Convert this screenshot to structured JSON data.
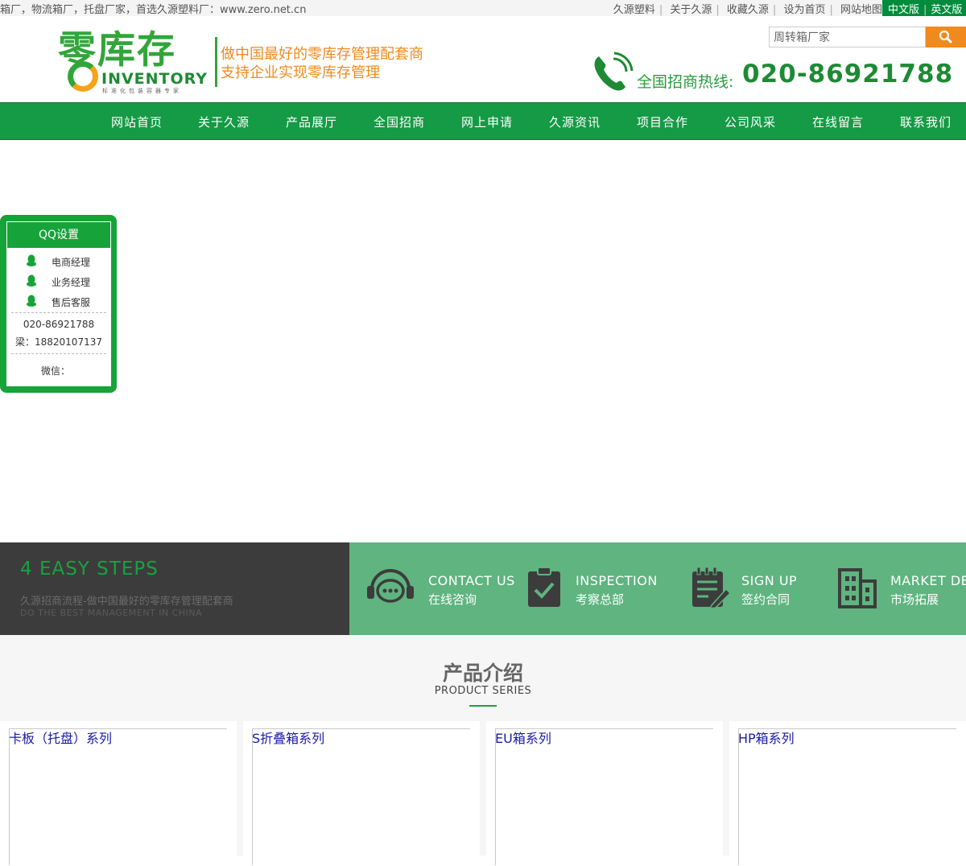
{
  "topbar": {
    "marquee": "箱厂，物流箱厂，托盘厂家，首选久源塑料厂：www.zero.net.cn",
    "links": [
      "久源塑料",
      "关于久源",
      "收藏久源",
      "设为首页",
      "网站地图"
    ],
    "lang_cn": "中文版",
    "lang_en": "英文版"
  },
  "logo": {
    "word": "零库存",
    "inventory": "INVENTORY",
    "small": "标准化包装容器专家",
    "slogan1": "做中国最好的零库存管理配套商",
    "slogan2": "支持企业实现零库存管理"
  },
  "search": {
    "value": "周转箱厂家"
  },
  "hotline": {
    "label": "全国招商热线:",
    "number": "020-86921788"
  },
  "nav": [
    "网站首页",
    "关于久源",
    "产品展厅",
    "全国招商",
    "网上申请",
    "久源资讯",
    "项目合作",
    "公司风采",
    "在线留言",
    "联系我们"
  ],
  "qq": {
    "title": "QQ设置",
    "contacts": [
      "电商经理",
      "业务经理",
      "售后客服"
    ],
    "phone": "020-86921788",
    "mobile": "梁：18820107137",
    "wechat": "微信："
  },
  "steps": {
    "heading": "4 EASY STEPS",
    "sub_cn": "久源招商流程-做中国最好的零库存管理配套商",
    "sub_en": "DO THE BEST MANAGEMENT IN CHINA",
    "items": [
      {
        "en": "CONTACT US",
        "cn": "在线咨询",
        "icon": "headset-chat-icon"
      },
      {
        "en": "INSPECTION",
        "cn": "考察总部",
        "icon": "clipboard-check-icon"
      },
      {
        "en": "SIGN UP",
        "cn": "签约合同",
        "icon": "notepad-pen-icon"
      },
      {
        "en": "MARKET DEV",
        "cn": "市场拓展",
        "icon": "building-icon"
      }
    ]
  },
  "products": {
    "title": "产品介绍",
    "subtitle": "PRODUCT SERIES",
    "items": [
      "卡板（托盘）系列",
      "S折叠箱系列",
      "EU箱系列",
      "HP箱系列"
    ]
  },
  "colors": {
    "brand_green": "#159a45",
    "accent_orange": "#f08a1c",
    "steps_green": "#5fb47f"
  }
}
